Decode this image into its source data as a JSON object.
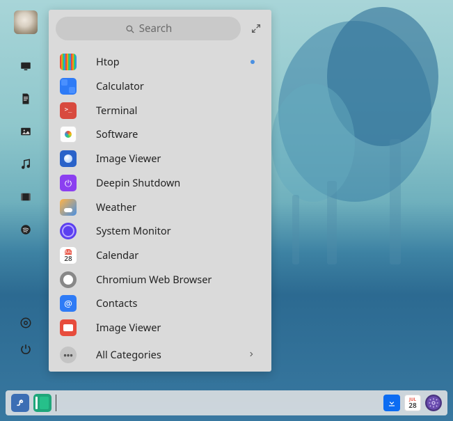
{
  "search": {
    "placeholder": "Search"
  },
  "dock": {
    "items": [
      {
        "name": "monitor-icon"
      },
      {
        "name": "document-icon"
      },
      {
        "name": "image-icon"
      },
      {
        "name": "music-icon"
      },
      {
        "name": "video-icon"
      },
      {
        "name": "spotify-icon"
      }
    ],
    "bottom": [
      {
        "name": "settings-icon"
      },
      {
        "name": "power-icon"
      }
    ]
  },
  "apps": [
    {
      "label": "Htop",
      "icon": "htop",
      "running": true
    },
    {
      "label": "Calculator",
      "icon": "calc",
      "running": false
    },
    {
      "label": "Terminal",
      "icon": "term",
      "running": false
    },
    {
      "label": "Software",
      "icon": "soft",
      "running": false
    },
    {
      "label": "Image Viewer",
      "icon": "imgv",
      "running": false
    },
    {
      "label": "Deepin Shutdown",
      "icon": "shut",
      "running": false
    },
    {
      "label": "Weather",
      "icon": "weat",
      "running": false
    },
    {
      "label": "System Monitor",
      "icon": "sysm",
      "running": false
    },
    {
      "label": "Calendar",
      "icon": "cal",
      "running": false
    },
    {
      "label": "Chromium Web Browser",
      "icon": "chro",
      "running": false
    },
    {
      "label": "Contacts",
      "icon": "cont",
      "running": false
    },
    {
      "label": "Image Viewer",
      "icon": "imgv2",
      "running": false
    }
  ],
  "all_categories": {
    "label": "All Categories"
  },
  "calendar_badge": {
    "month": "JUL",
    "day": "28"
  },
  "taskbar": {
    "tray_calendar": {
      "month": "JUL",
      "day": "28"
    }
  }
}
